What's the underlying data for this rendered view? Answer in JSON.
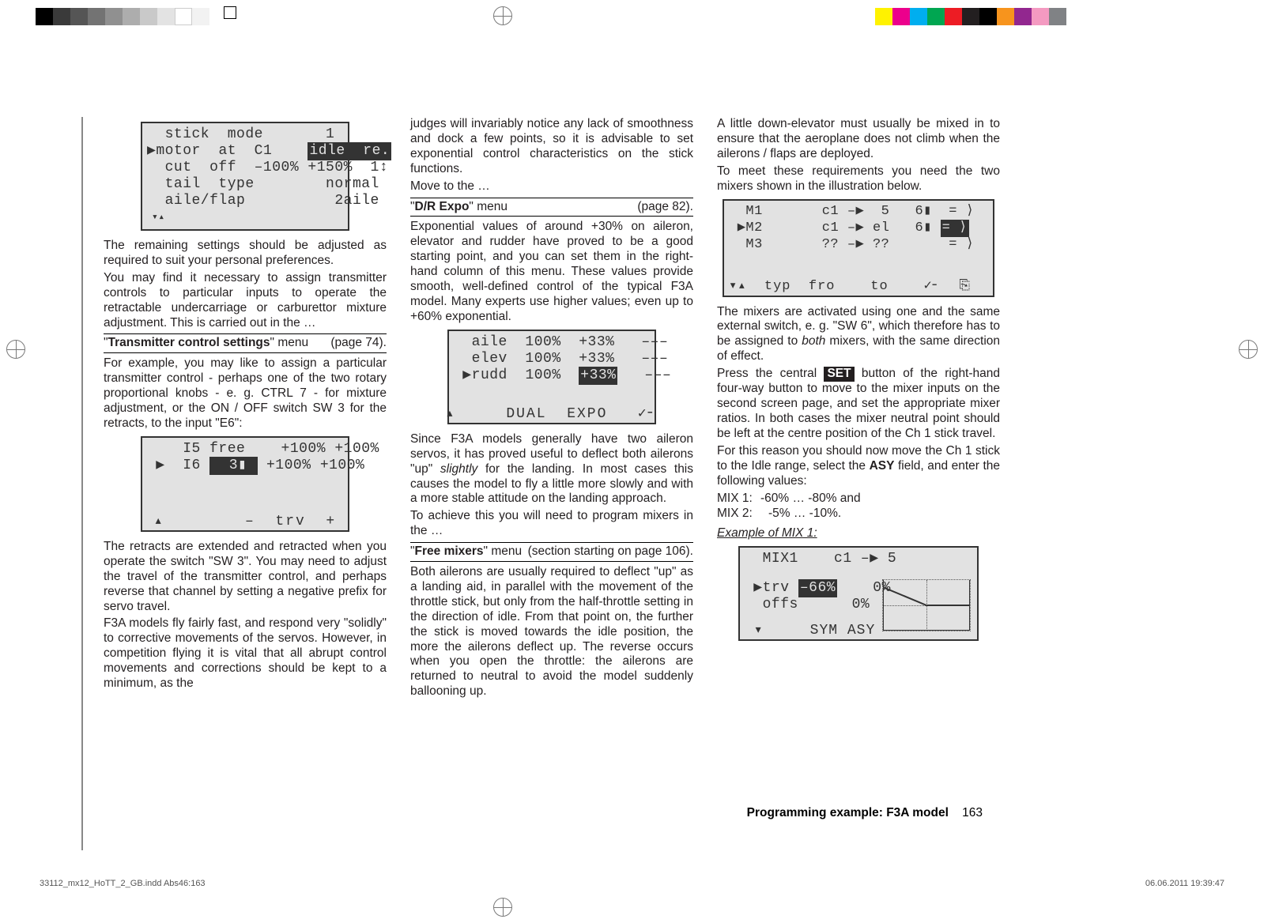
{
  "registration": {
    "left_swatches": [
      "#000000",
      "#3a3a3a",
      "#555555",
      "#737373",
      "#909090",
      "#adadad",
      "#c9c9c9",
      "#e3e3e3",
      "#ffffff",
      "#f2f2f2"
    ],
    "right_swatches": [
      "#fff200",
      "#ec008c",
      "#00aeef",
      "#00a651",
      "#ed1c24",
      "#231f20",
      "#000000",
      "#f7941d",
      "#92278f",
      "#f49ac1",
      "#808285"
    ]
  },
  "col1": {
    "lcd1": {
      "r1": "  stick  mode       1",
      "r2_pre": "▶motor  at  C1    ",
      "r2_sel": "idle  re.",
      "r3": "  cut  off  –100% +150%  1↕",
      "r4": "  tail  type        normal",
      "r5": "  aile/flap          2aile"
    },
    "p1": "The remaining settings should be adjusted as required to suit your personal preferences.",
    "p2": "You may find it necessary to assign transmitter controls to particular inputs to operate the retractable undercarriage or carburettor mixture adjustment. This is carried out in the …",
    "menuA": {
      "title_b": "Transmitter control settings",
      "title_tail": " menu",
      "page": "(page 74)."
    },
    "p3": "For example, you may like to assign a particular transmitter control - perhaps one of the two rotary proportional knobs - e. g. CTRL 7 - for mixture adjustment, or the ON / OFF switch SW 3 for the retracts, to the input \"E6\":",
    "lcd2": {
      "r1": "    I5 free    +100% +100%",
      "r2_pre": " ▶  I6 ",
      "r2_sel": "  3▮ ",
      "r2_post": " +100% +100%",
      "footer": "▴        –  trv  +"
    },
    "p4": "The retracts are extended and retracted when you operate the switch \"SW 3\". You may need to adjust the travel of the transmitter control, and perhaps reverse that channel by setting a negative prefix for servo travel.",
    "p5": "F3A models fly fairly fast, and respond very \"solidly\" to corrective movements of the servos. However, in competition flying it is vital that all abrupt control movements and corrections should be kept to a minimum, as the"
  },
  "col2": {
    "p1": "judges will invariably notice any lack of smoothness and dock a few points, so it is advisable to set exponential control characteristics on the stick functions.",
    "p2": "Move to the …",
    "menuB": {
      "title_b": "D/R Expo",
      "title_tail": " menu",
      "page": "(page 82)."
    },
    "p3": "Exponential values of around +30% on aileron, elevator and rudder have proved to be a good starting point, and you can set them in the right-hand column of this menu. These values provide smooth, well-defined control of the typical F3A model. Many experts use higher values; even up to +60% exponential.",
    "lcd3": {
      "r1": "  aile  100%  +33%   –––",
      "r2": "  elev  100%  +33%   –––",
      "r3_pre": " ▶rudd  100%  ",
      "r3_sel": "+33%",
      "r3_post": "   –––",
      "footer": "▴     DUAL  EXPO   ✓╴"
    },
    "p4a": "Since F3A models generally have two aileron servos, it has proved useful to deflect both ailerons \"up\" ",
    "p4b": "slightly",
    "p4c": " for the landing. In most cases this causes the model to fly a little more slowly and with a more stable attitude on the landing approach.",
    "p5": "To achieve this you will need to program mixers in the …",
    "menuC": {
      "title_b": "Free mixers",
      "title_tail": " menu",
      "page": "(section starting on page 106)."
    },
    "p6": "Both ailerons are usually required to deflect \"up\" as a landing aid, in parallel with the movement of the throttle stick, but only from the half-throttle setting in the direction of idle. From that point on, the further the stick is moved towards the idle position, the more the ailerons deflect up. The reverse occurs when you open the throttle: the ailerons are returned to neutral to avoid the model suddenly ballooning up."
  },
  "col3": {
    "p1": "A little down-elevator must usually be mixed in to ensure that the aeroplane does not climb when the ailerons / flaps are deployed.",
    "p2": "To meet these requirements you need the two mixers shown in the illustration below.",
    "lcd4": {
      "r1": "  M1       c1 –▶  5   6▮  = ⟩",
      "r2_pre": " ▶M2       c1 –▶ el   6▮ ",
      "r2_sel": "= ⟩",
      "r3": "  M3       ?? –▶ ??       = ⟩",
      "footer": "▾▴  typ  fro    to    ✓╴  ⎘"
    },
    "p3a": "The mixers are activated using one and the same external switch, e. g. \"SW 6\", which therefore has to be assigned to ",
    "p3b": "both",
    "p3c": " mixers, with the same direction of effect.",
    "p4a": "Press the central ",
    "p4set": "SET",
    "p4b": " button of the right-hand four-way button to move to the mixer inputs on the second screen page, and set the appropriate mixer ratios. In both cases the mixer neutral point should be left at the centre position of the Ch 1 stick travel.",
    "p5a": "For this reason you should now move the Ch 1 stick to the Idle range, select the ",
    "p5b": "ASY",
    "p5c": " field, and enter the following values:",
    "mix1lab": "MIX 1:",
    "mix1val": "-60% … -80% and",
    "mix2lab": "MIX 2:",
    "mix2val": "-5% … -10%.",
    "example": "Example of MIX 1:",
    "lcd5": {
      "r1": "  MIX1    c1 –▶ 5",
      "r2_pre": " ▶trv ",
      "r2_sel": "–66%",
      "r2_post": "    0%",
      "r3": "  offs      0%",
      "footer": " ▾     SYM ASY"
    }
  },
  "footer": {
    "title": "Programming example: F3A model",
    "page": "163"
  },
  "meta": {
    "left": "33112_mx12_HoTT_2_GB.indd   Abs46:163",
    "right": "06.06.2011   19:39:47"
  }
}
